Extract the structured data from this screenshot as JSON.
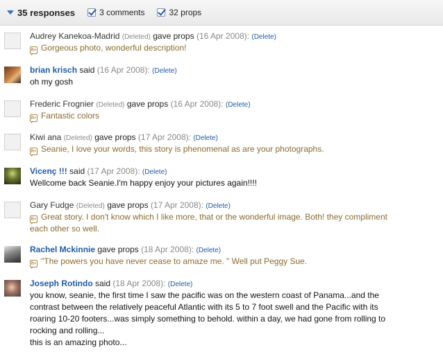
{
  "header": {
    "responses_label": "35 responses",
    "comments_label": "3 comments",
    "props_label": "32 props"
  },
  "entries": [
    {
      "name": "Audrey Kanekoa-Madrid",
      "deleted": "(Deleted)",
      "action": "gave props",
      "date": "(16 Apr 2008):",
      "delete": "(Delete)",
      "text": "Gorgeous photo, wonderful description!"
    },
    {
      "name": "brian krisch",
      "action": "said",
      "date": "(16 Apr 2008):",
      "delete": "(Delete)",
      "text": "oh my gosh"
    },
    {
      "name": "Frederic Frognier",
      "deleted": "(Deleted)",
      "action": "gave props",
      "date": "(16 Apr 2008):",
      "delete": "(Delete)",
      "text": "Fantastic colors"
    },
    {
      "name": "Kiwi ana",
      "deleted": "(Deleted)",
      "action": "gave props",
      "date": "(17 Apr 2008):",
      "delete": "(Delete)",
      "text": "Seanie, I love your words, this story is phenomenal as are your photographs."
    },
    {
      "name": "Vicenç !!!",
      "action": "said",
      "date": "(17 Apr 2008):",
      "delete": "(Delete)",
      "text": "Wellcome back Seanie.I'm happy enjoy your pictures again!!!!"
    },
    {
      "name": "Gary Fudge",
      "deleted": "(Deleted)",
      "action": "gave props",
      "date": "(17 Apr 2008):",
      "delete": "(Delete)",
      "text_lines": [
        "Great story. I don't know which I like more, that or the wonderful image. Both! they compliment",
        "each other so well."
      ]
    },
    {
      "name": "Rachel Mckinnie",
      "action": "gave props",
      "date": "(18 Apr 2008):",
      "delete": "(Delete)",
      "text": "\"The powers you have never cease to amaze me. \" Well put Peggy Sue."
    },
    {
      "name": "Joseph Rotindo",
      "action": "said",
      "date": "(18 Apr 2008):",
      "delete": "(Delete)",
      "text_lines": [
        "you know, seanie, the first time I saw the pacific was on the western coast of Panama...and the",
        "contrast between the relatively peaceful Atlantic with its 5 to 7 foot swell and the Pacific with its",
        "roaring 10-20 footers...was simply something to behold. within a day, we had gone from rolling to",
        "rocking and rolling...",
        "this is an amazing photo..."
      ]
    }
  ],
  "props_icon_text": "R+"
}
